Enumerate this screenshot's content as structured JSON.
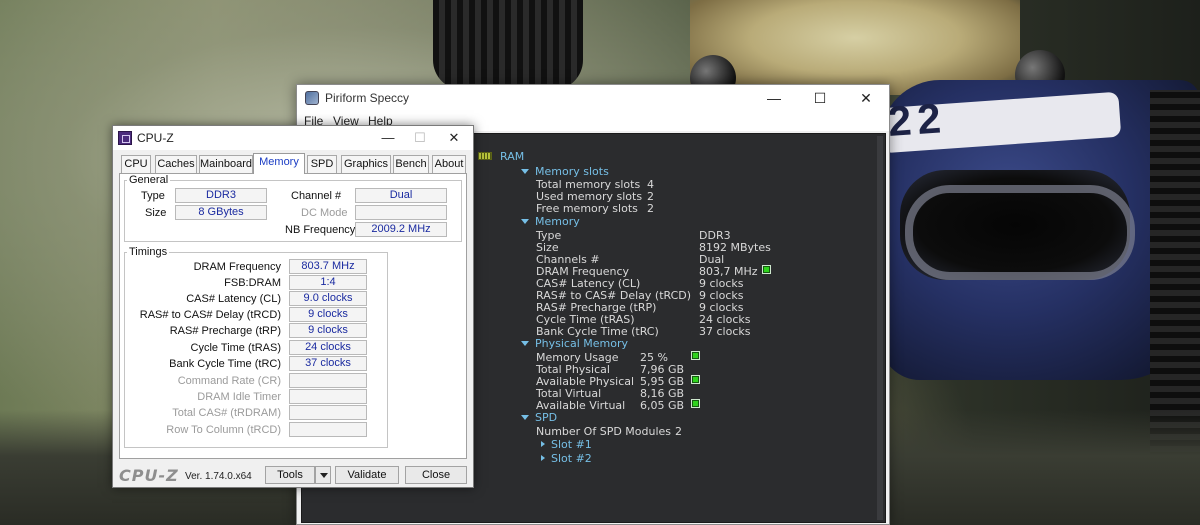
{
  "desktop": {
    "car_number": "22"
  },
  "speccy": {
    "title": "Piriform Speccy",
    "window_buttons": {
      "minimize": "—",
      "maximize": "☐",
      "close": "✕"
    },
    "menu": [
      "File",
      "View",
      "Help"
    ],
    "section": "RAM",
    "memory_slots": {
      "heading": "Memory slots",
      "rows": [
        {
          "label": "Total memory slots",
          "value": "4"
        },
        {
          "label": "Used memory slots",
          "value": "2"
        },
        {
          "label": "Free memory slots",
          "value": "2"
        }
      ]
    },
    "memory": {
      "heading": "Memory",
      "rows": [
        {
          "label": "Type",
          "value": "DDR3"
        },
        {
          "label": "Size",
          "value": "8192 MBytes"
        },
        {
          "label": "Channels #",
          "value": "Dual"
        },
        {
          "label": "DRAM Frequency",
          "value": "803,7 MHz"
        },
        {
          "label": "CAS# Latency (CL)",
          "value": "9 clocks"
        },
        {
          "label": "RAS# to CAS# Delay (tRCD)",
          "value": "9 clocks"
        },
        {
          "label": "RAS# Precharge (tRP)",
          "value": "9 clocks"
        },
        {
          "label": "Cycle Time (tRAS)",
          "value": "24 clocks"
        },
        {
          "label": "Bank Cycle Time (tRC)",
          "value": "37 clocks"
        }
      ]
    },
    "physical_memory": {
      "heading": "Physical Memory",
      "rows": [
        {
          "label": "Memory Usage",
          "value": "25 %"
        },
        {
          "label": "Total Physical",
          "value": "7,96 GB"
        },
        {
          "label": "Available Physical",
          "value": "5,95 GB"
        },
        {
          "label": "Total Virtual",
          "value": "8,16 GB"
        },
        {
          "label": "Available Virtual",
          "value": "6,05 GB"
        }
      ]
    },
    "spd": {
      "heading": "SPD",
      "modules_label": "Number Of SPD Modules",
      "modules_value": "2",
      "slots": [
        "Slot #1",
        "Slot #2"
      ]
    },
    "colors": {
      "panel_bg": "#2b2c2e",
      "heading": "#76bfe6",
      "indicator": "#2fd31d"
    }
  },
  "cpuz": {
    "title": "CPU-Z",
    "window_buttons": {
      "minimize": "—",
      "maximize": "☐",
      "close": "✕"
    },
    "tabs": [
      "CPU",
      "Caches",
      "Mainboard",
      "Memory",
      "SPD",
      "Graphics",
      "Bench",
      "About"
    ],
    "active_tab": "Memory",
    "general": {
      "title": "General",
      "type_label": "Type",
      "type_value": "DDR3",
      "size_label": "Size",
      "size_value": "8 GBytes",
      "channel_label": "Channel #",
      "channel_value": "Dual",
      "dcmode_label": "DC Mode",
      "dcmode_value": "",
      "nbfreq_label": "NB Frequency",
      "nbfreq_value": "2009.2 MHz"
    },
    "timings": {
      "title": "Timings",
      "rows": [
        {
          "label": "DRAM Frequency",
          "value": "803.7 MHz",
          "enabled": true
        },
        {
          "label": "FSB:DRAM",
          "value": "1:4",
          "enabled": true
        },
        {
          "label": "CAS# Latency (CL)",
          "value": "9.0 clocks",
          "enabled": true
        },
        {
          "label": "RAS# to CAS# Delay (tRCD)",
          "value": "9 clocks",
          "enabled": true
        },
        {
          "label": "RAS# Precharge (tRP)",
          "value": "9 clocks",
          "enabled": true
        },
        {
          "label": "Cycle Time (tRAS)",
          "value": "24 clocks",
          "enabled": true
        },
        {
          "label": "Bank Cycle Time (tRC)",
          "value": "37 clocks",
          "enabled": true
        },
        {
          "label": "Command Rate (CR)",
          "value": "",
          "enabled": false
        },
        {
          "label": "DRAM Idle Timer",
          "value": "",
          "enabled": false
        },
        {
          "label": "Total CAS# (tRDRAM)",
          "value": "",
          "enabled": false
        },
        {
          "label": "Row To Column (tRCD)",
          "value": "",
          "enabled": false
        }
      ]
    },
    "footer": {
      "logo": "CPU-Z",
      "version": "Ver. 1.74.0.x64",
      "tools_label": "Tools",
      "validate_label": "Validate",
      "close_label": "Close"
    },
    "colors": {
      "value_text": "#1a2aa0",
      "active_tab_text": "#1a3cc4"
    }
  }
}
